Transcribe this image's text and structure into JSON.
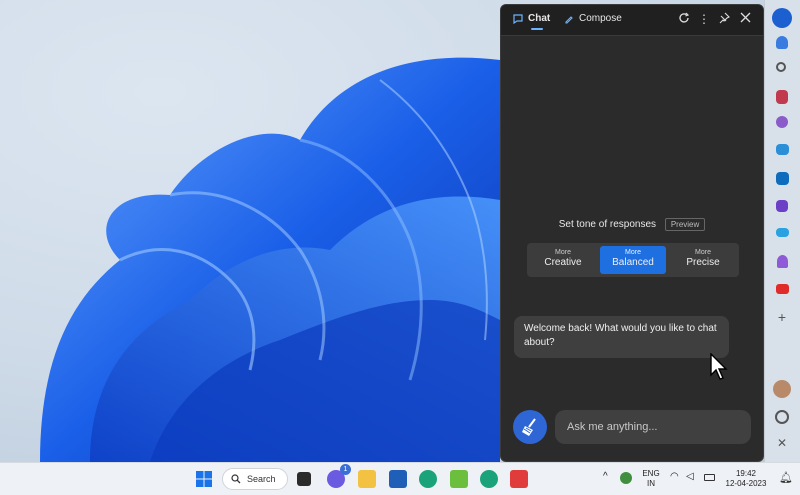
{
  "panel": {
    "tabs": [
      {
        "label": "Chat",
        "active": true,
        "icon": "chat-icon"
      },
      {
        "label": "Compose",
        "active": false,
        "icon": "compose-icon"
      }
    ],
    "header_icons": [
      "refresh-icon",
      "more-icon",
      "pin-icon",
      "close-icon"
    ],
    "tone": {
      "label": "Set tone of responses",
      "badge": "Preview",
      "options": [
        {
          "small": "More",
          "label": "Creative",
          "selected": false
        },
        {
          "small": "More",
          "label": "Balanced",
          "selected": true
        },
        {
          "small": "More",
          "label": "Precise",
          "selected": false
        }
      ]
    },
    "message": "Welcome back! What would you like to chat about?",
    "input_placeholder": "Ask me anything..."
  },
  "taskbar": {
    "search_label": "Search",
    "chat_badge": "1",
    "language": {
      "line1": "ENG",
      "line2": "IN"
    },
    "clock": {
      "time": "19:42",
      "date": "12-04-2023"
    }
  },
  "colors": {
    "accent": "#1e6fe0",
    "panel_bg": "#2b2b2b"
  }
}
